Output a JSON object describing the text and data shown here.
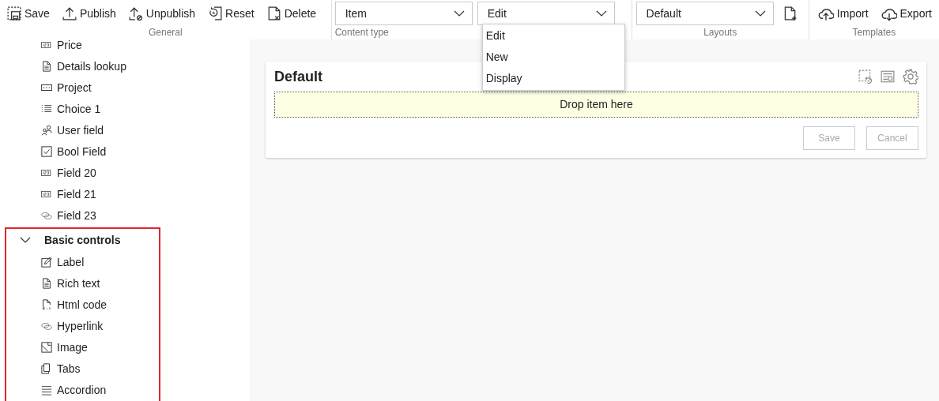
{
  "toolbar": {
    "groups": [
      {
        "label": "General",
        "buttons": [
          {
            "label": "Save",
            "kind": "save"
          },
          {
            "label": "Publish",
            "kind": "publish"
          },
          {
            "label": "Unpublish",
            "kind": "unpublish"
          },
          {
            "label": "Reset",
            "kind": "reset"
          },
          {
            "label": "Delete",
            "kind": "delete"
          }
        ]
      },
      {
        "label": "Content type",
        "dropdowns": [
          {
            "value": "Item"
          },
          {
            "value": "Edit",
            "open": true,
            "options": [
              {
                "label": "Edit"
              },
              {
                "label": "New"
              },
              {
                "label": "Display"
              }
            ]
          }
        ]
      },
      {
        "label": "Layouts",
        "dropdowns": [
          {
            "value": "Default"
          }
        ],
        "buttons": [
          {
            "kind": "new-layout"
          }
        ]
      },
      {
        "label": "Templates",
        "buttons": [
          {
            "label": "Import",
            "kind": "import"
          },
          {
            "label": "Export",
            "kind": "export"
          }
        ]
      }
    ]
  },
  "sidebar": {
    "items": [
      {
        "label": "Price",
        "kind": "number"
      },
      {
        "label": "Details lookup",
        "kind": "document"
      },
      {
        "label": "Project",
        "kind": "lookup"
      },
      {
        "label": "Choice 1",
        "kind": "choice"
      },
      {
        "label": "User field",
        "kind": "user"
      },
      {
        "label": "Bool Field",
        "kind": "checkbox"
      },
      {
        "label": "Field 20",
        "kind": "number"
      },
      {
        "label": "Field 21",
        "kind": "number"
      },
      {
        "label": "Field 23",
        "kind": "link"
      }
    ],
    "groups": [
      {
        "label": "Basic controls",
        "expanded": true,
        "highlighted": true,
        "items": [
          {
            "label": "Label",
            "kind": "label"
          },
          {
            "label": "Rich text",
            "kind": "document"
          },
          {
            "label": "Html code",
            "kind": "code"
          },
          {
            "label": "Hyperlink",
            "kind": "link"
          },
          {
            "label": "Image",
            "kind": "image"
          },
          {
            "label": "Tabs",
            "kind": "tabs"
          },
          {
            "label": "Accordion",
            "kind": "accordion"
          }
        ]
      }
    ]
  },
  "form": {
    "title": "Default",
    "dropzone": "Drop item here",
    "buttons": [
      {
        "label": "Save",
        "disabled": true
      },
      {
        "label": "Cancel",
        "disabled": true
      }
    ]
  }
}
